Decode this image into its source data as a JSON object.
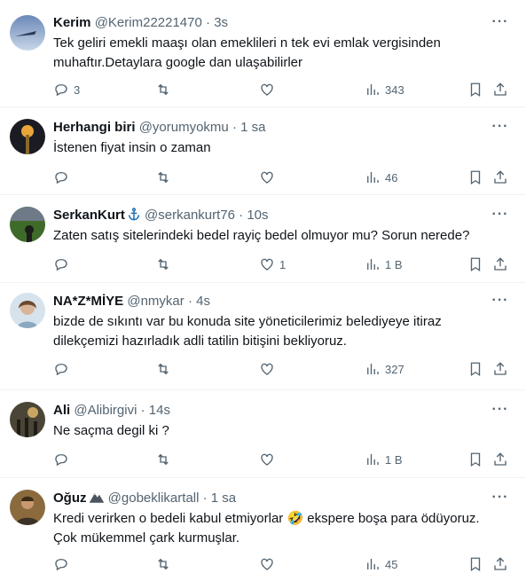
{
  "tweets": [
    {
      "name": "Kerim",
      "handle": "@Kerim22221470",
      "time": "3s",
      "badge": "",
      "text": [
        "Tek geliri emekli maaşı olan emeklileri n tek evi emlak vergisinden",
        "muhaftır.Detaylara google dan ulaşabilirler"
      ],
      "replies": "3",
      "retweets": "",
      "likes": "",
      "views": "343",
      "avatar_icon": "sky-avatar"
    },
    {
      "name": "Herhangi biri",
      "handle": "@yorumyokmu",
      "time": "1 sa",
      "badge": "",
      "text": [
        "İstenen fiyat insin o zaman"
      ],
      "replies": "",
      "retweets": "",
      "likes": "",
      "views": "46",
      "avatar_icon": "tower-avatar"
    },
    {
      "name": "SerkanKurt",
      "handle": "@serkankurt76",
      "time": "10s",
      "badge": "anchor-icon",
      "text": [
        "Zaten satış sitelerindeki bedel rayiç bedel olmuyor mu? Sorun nerede?"
      ],
      "replies": "",
      "retweets": "",
      "likes": "1",
      "views": "1 B",
      "avatar_icon": "stadium-avatar"
    },
    {
      "name": "NA*Z*MİYE",
      "handle": "@nmykar",
      "time": "4s",
      "badge": "",
      "text": [
        "bizde de sıkıntı var bu konuda site yöneticilerimiz  belediyeye  itiraz",
        "dilekçemizi hazırladık  adli tatilin bitişini bekliyoruz."
      ],
      "replies": "",
      "retweets": "",
      "likes": "",
      "views": "327",
      "avatar_icon": "portrait-avatar"
    },
    {
      "name": "Ali",
      "handle": "@Alibirgivi",
      "time": "14s",
      "badge": "",
      "text": [
        "Ne saçma degil ki ?"
      ],
      "replies": "",
      "retweets": "",
      "likes": "",
      "views": "1 B",
      "avatar_icon": "forest-avatar"
    },
    {
      "name": "Oğuz",
      "handle": "@gobeklikartall",
      "time": "1 sa",
      "badge": "mountain-icon",
      "text": [
        "Kredi verirken o bedeli kabul etmiyorlar 🤣 ekspere boşa para ödüyoruz.",
        "Çok mükemmel çark kurmuşlar."
      ],
      "replies": "",
      "retweets": "",
      "likes": "",
      "views": "45",
      "avatar_icon": "man-avatar"
    }
  ],
  "more_label": "···",
  "separator": "·"
}
